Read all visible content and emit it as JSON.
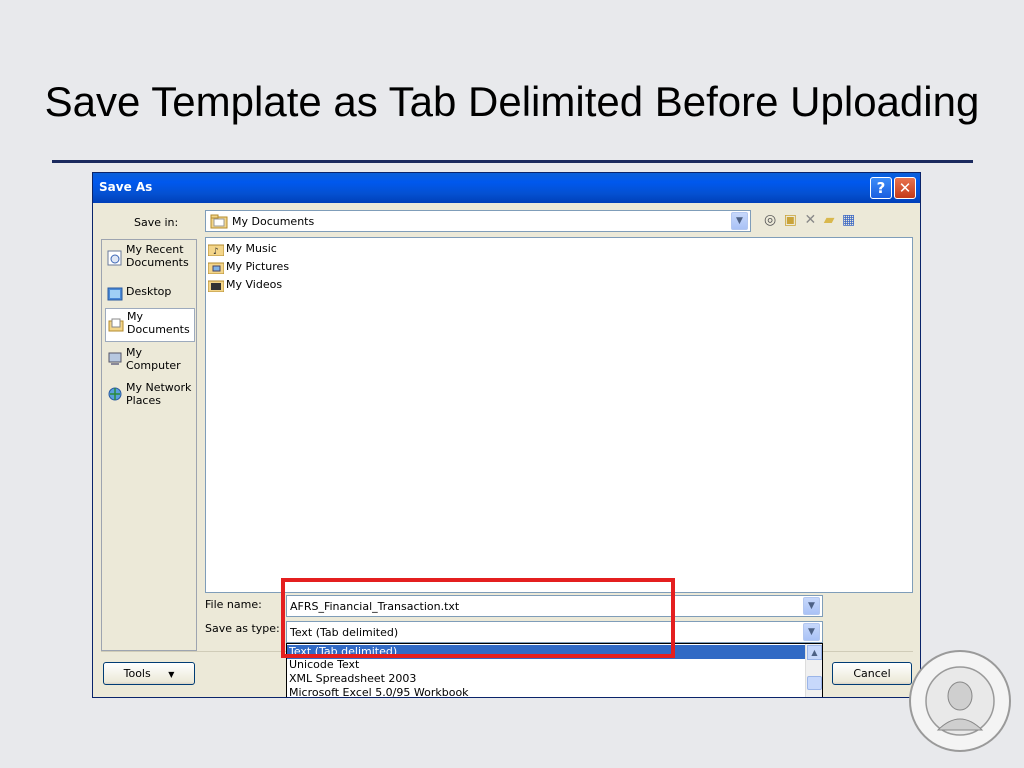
{
  "slide": {
    "title": "Save Template as Tab Delimited Before Uploading"
  },
  "dialog": {
    "title": "Save As",
    "help_button": "?",
    "close_button": "✕",
    "save_in_label": "Save in:",
    "save_in_value": "My Documents",
    "places": [
      {
        "label": "My Recent Documents",
        "icon": "recent-documents-icon"
      },
      {
        "label": "Desktop",
        "icon": "desktop-icon"
      },
      {
        "label": "My Documents",
        "icon": "my-documents-icon"
      },
      {
        "label": "My Computer",
        "icon": "my-computer-icon"
      },
      {
        "label": "My Network Places",
        "icon": "network-places-icon"
      }
    ],
    "files": [
      {
        "name": "My Music",
        "icon": "music-folder-icon"
      },
      {
        "name": "My Pictures",
        "icon": "pictures-folder-icon"
      },
      {
        "name": "My Videos",
        "icon": "videos-folder-icon"
      }
    ],
    "file_name_label": "File name:",
    "file_name_value": "AFRS_Financial_Transaction.txt",
    "save_as_type_label": "Save as type:",
    "save_as_type_value": "Text (Tab delimited)",
    "type_options": [
      "Text (Tab delimited)",
      "Unicode Text",
      "XML Spreadsheet 2003",
      "Microsoft Excel 5.0/95 Workbook"
    ],
    "tools_button": "Tools",
    "cancel_button": "Cancel"
  },
  "colors": {
    "highlight": "#e41f1f",
    "titlebar": "#0058ee",
    "selection": "#316ac5",
    "rule": "#1b2a5e"
  }
}
